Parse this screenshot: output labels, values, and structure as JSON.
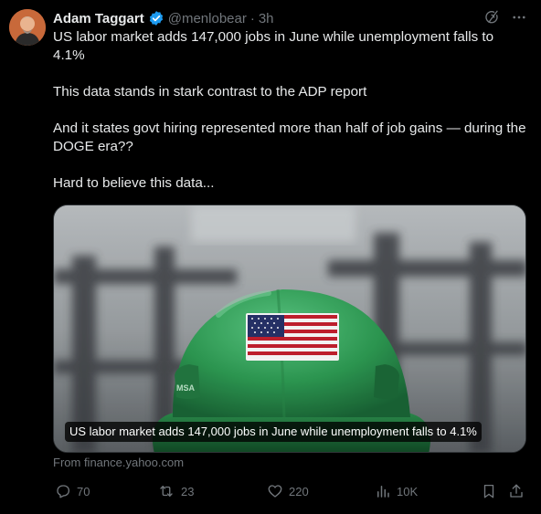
{
  "author": {
    "name": "Adam Taggart",
    "handle": "@menlobear",
    "separator": "·",
    "time": "3h"
  },
  "tweet": {
    "paragraphs": [
      "US labor market adds 147,000 jobs in June while unemployment falls to 4.1%",
      "This data stands in stark contrast to the ADP report",
      "And it states govt hiring represented more than half of job gains — during the DOGE era??",
      "Hard to believe this data..."
    ]
  },
  "media": {
    "caption": "US labor market adds 147,000 jobs in June while unemployment falls to 4.1%",
    "helmet_label": "MSA",
    "helmet_color": "#2f9e55"
  },
  "link_source": "From finance.yahoo.com",
  "actions": {
    "replies": "70",
    "reposts": "23",
    "likes": "220",
    "views": "10K"
  },
  "colors": {
    "background": "#000000",
    "text": "#e7e9ea",
    "muted": "#71767b",
    "verified": "#1d9bf0"
  }
}
